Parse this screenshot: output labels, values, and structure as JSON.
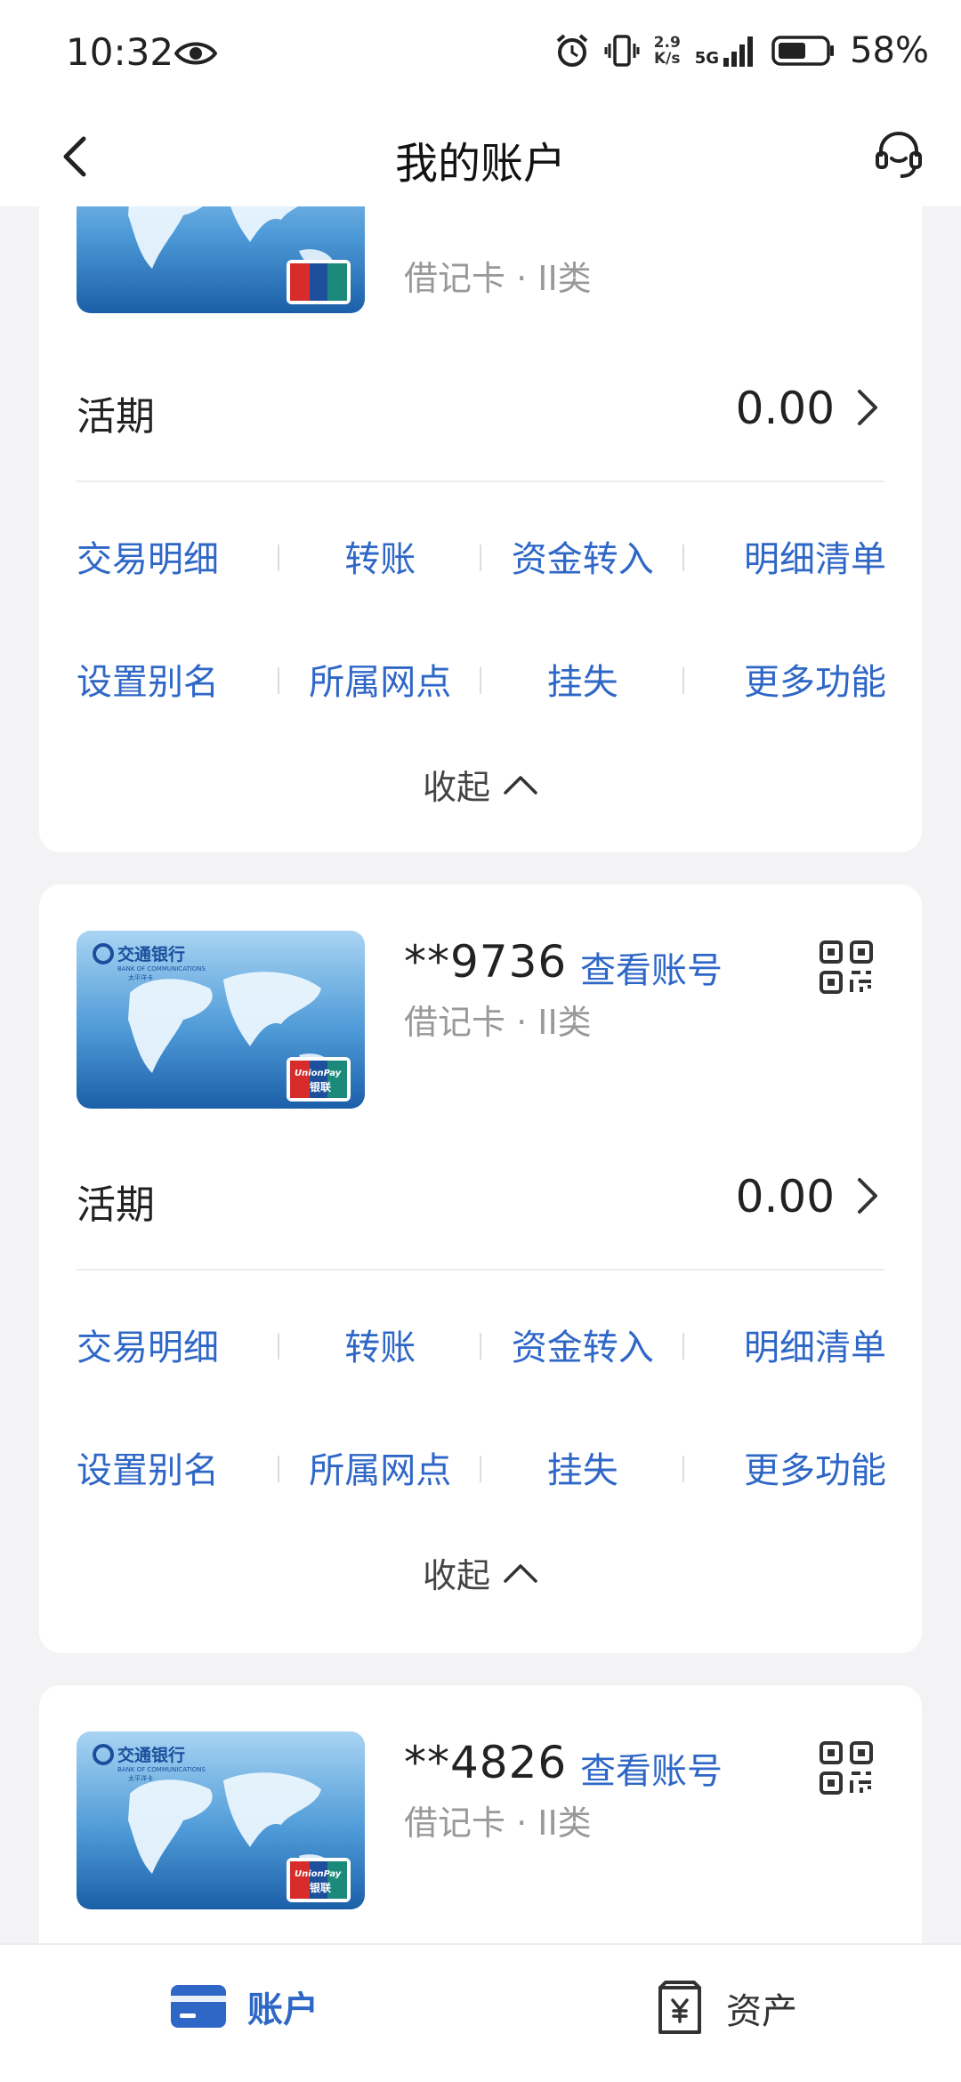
{
  "status_bar": {
    "time": "10:32",
    "speed_value": "2.9",
    "speed_unit": "K/s",
    "network": "5G",
    "battery": "58%"
  },
  "header": {
    "title": "我的账户"
  },
  "accounts": [
    {
      "card_type": "借记卡 · II类",
      "balance_label": "活期",
      "balance": "0.00"
    },
    {
      "masked_number": "**9736",
      "view_label": "查看账号",
      "card_type": "借记卡 · II类",
      "balance_label": "活期",
      "balance": "0.00"
    },
    {
      "masked_number": "**4826",
      "view_label": "查看账号",
      "card_type": "借记卡 · II类"
    }
  ],
  "actions": [
    "交易明细",
    "转账",
    "资金转入",
    "明细清单",
    "设置别名",
    "所属网点",
    "挂失",
    "更多功能"
  ],
  "collapse_label": "收起",
  "card_art": {
    "bank_name": "交通银行",
    "bank_name_en": "BANK OF COMMUNICATIONS",
    "card_series": "太平洋卡",
    "unionpay_en": "UnionPay",
    "unionpay_cn": "银联"
  },
  "bottom_nav": {
    "accounts_label": "账户",
    "assets_label": "资产"
  },
  "colors": {
    "accent": "#2f67c7",
    "background": "#f3f3f5"
  }
}
